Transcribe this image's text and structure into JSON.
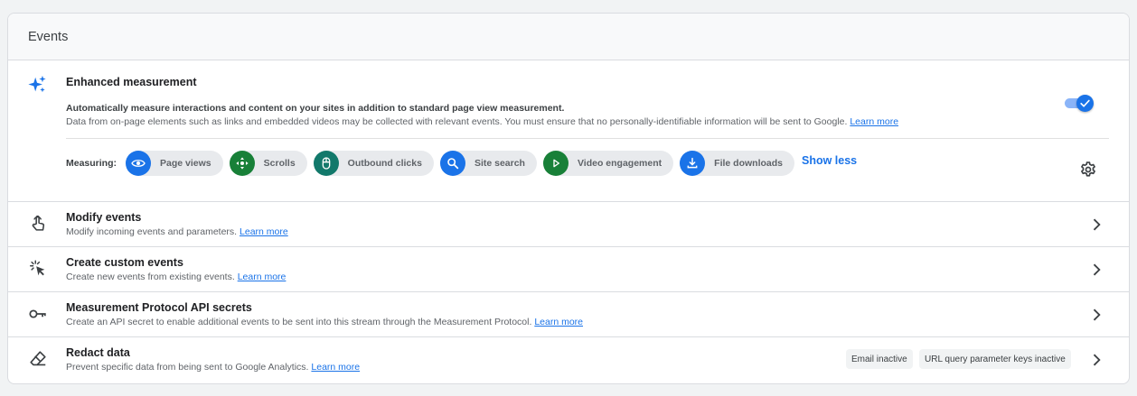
{
  "card": {
    "title": "Events"
  },
  "enhanced": {
    "icon": "sparkle-icon",
    "title": "Enhanced measurement",
    "desc_bold": "Automatically measure interactions and content on your sites in addition to standard page view measurement.",
    "desc": "Data from on-page elements such as links and embedded videos may be collected with relevant events. You must ensure that no personally-identifiable information will be sent to Google.",
    "learn_more": "Learn more",
    "toggle_on": true,
    "measuring_label": "Measuring:",
    "chips": [
      {
        "label": "Page views",
        "icon": "eye-icon",
        "color": "#1a73e8"
      },
      {
        "label": "Scrolls",
        "icon": "scroll-crosshair-icon",
        "color": "#188038"
      },
      {
        "label": "Outbound clicks",
        "icon": "mouse-icon",
        "color": "#12796b"
      },
      {
        "label": "Site search",
        "icon": "search-icon",
        "color": "#1a73e8"
      },
      {
        "label": "Video engagement",
        "icon": "play-icon",
        "color": "#188038"
      },
      {
        "label": "File downloads",
        "icon": "download-icon",
        "color": "#1a73e8"
      }
    ],
    "show_less": "Show less",
    "settings_icon": "gear-icon"
  },
  "rows": [
    {
      "icon": "touch-hand-icon",
      "title": "Modify events",
      "desc": "Modify incoming events and parameters.",
      "learn_more": "Learn more"
    },
    {
      "icon": "click-sparkle-icon",
      "title": "Create custom events",
      "desc": "Create new events from existing events.",
      "learn_more": "Learn more"
    },
    {
      "icon": "key-icon",
      "title": "Measurement Protocol API secrets",
      "desc": "Create an API secret to enable additional events to be sent into this stream through the Measurement Protocol.",
      "learn_more": "Learn more"
    },
    {
      "icon": "eraser-icon",
      "title": "Redact data",
      "desc": "Prevent specific data from being sent to Google Analytics.",
      "learn_more": "Learn more",
      "badges": [
        "Email inactive",
        "URL query parameter keys inactive"
      ]
    }
  ],
  "colors": {
    "accent": "#1a73e8",
    "green": "#188038",
    "teal": "#12796b"
  }
}
